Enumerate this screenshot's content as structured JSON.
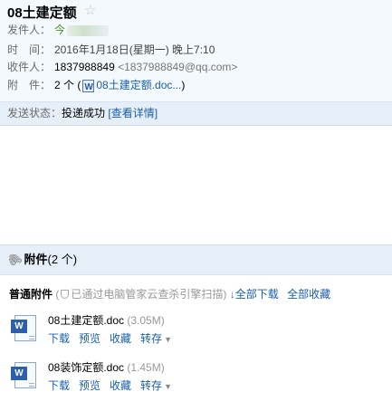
{
  "mail": {
    "subject": "08土建定额",
    "sender_label": "发件人：",
    "sender_name": "今",
    "time_label": "时　间：",
    "time_value": "2016年1月18日(星期一) 晚上7:10",
    "recipient_label": "收件人：",
    "recipient_name": "1837988849",
    "recipient_addr": "<1837988849@qq.com>",
    "attach_label": "附　件：",
    "attach_count": "2 个 (",
    "attach_link": "08土建定额.doc...",
    "attach_close": ")"
  },
  "status": {
    "label": "发送状态：",
    "value": "投递成功",
    "detail": "[查看详情]"
  },
  "attachments": {
    "title": "附件",
    "count": "(2 个)",
    "section_title": "普通附件",
    "scan_open": "(",
    "scan_text": "已通过电脑管家云查杀引擎扫描)",
    "download_all": "全部下载",
    "collect_all": "全部收藏",
    "files": [
      {
        "name": "08土建定额.doc",
        "size": "(3.05M)",
        "icon": "word-doc-icon",
        "actions": [
          "下载",
          "预览",
          "收藏",
          "转存"
        ]
      },
      {
        "name": "08装饰定额.doc",
        "size": "(1.45M)",
        "icon": "word-doc-icon",
        "actions": [
          "下载",
          "预览",
          "收藏",
          "转存"
        ]
      }
    ]
  }
}
